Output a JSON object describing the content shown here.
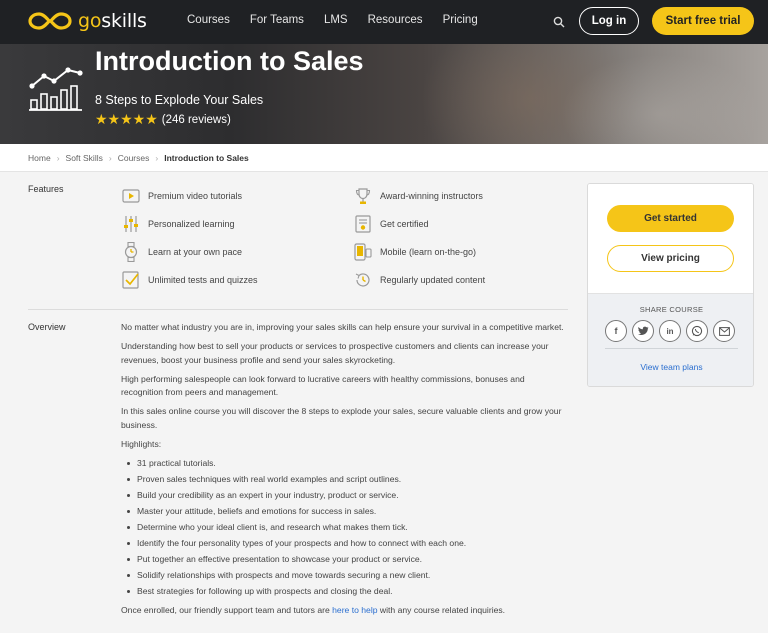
{
  "nav": {
    "logo_go": "go",
    "logo_rest": "skills",
    "links": [
      "Courses",
      "For Teams",
      "LMS",
      "Resources",
      "Pricing"
    ],
    "login": "Log in",
    "trial": "Start free trial"
  },
  "hero": {
    "title": "Introduction to Sales",
    "subtitle": "8 Steps to Explode Your Sales",
    "stars": "★★★★★",
    "rating": 5,
    "reviews": "(246 reviews)"
  },
  "breadcrumb": [
    "Home",
    "Soft Skills",
    "Courses",
    "Introduction to Sales"
  ],
  "features": {
    "label": "Features",
    "left": [
      {
        "label": "Premium video tutorials",
        "icon": "video-icon"
      },
      {
        "label": "Personalized learning",
        "icon": "sliders-icon"
      },
      {
        "label": "Learn at your own pace",
        "icon": "watch-icon"
      },
      {
        "label": "Unlimited tests and quizzes",
        "icon": "checklist-icon"
      }
    ],
    "right": [
      {
        "label": "Award-winning instructors",
        "icon": "trophy-icon"
      },
      {
        "label": "Get certified",
        "icon": "certificate-icon"
      },
      {
        "label": "Mobile (learn on-the-go)",
        "icon": "mobile-icon"
      },
      {
        "label": "Regularly updated content",
        "icon": "history-icon"
      }
    ]
  },
  "overview": {
    "label": "Overview",
    "paragraphs": [
      "No matter what industry you are in, improving your sales skills can help ensure your survival in a competitive market.",
      "Understanding how best to sell your products or services to prospective customers and clients can increase your revenues, boost your business profile and send your sales skyrocketing.",
      "High performing salespeople can look forward to lucrative careers with healthy commissions, bonuses and recognition from peers and management.",
      "In this sales online course you will discover the 8 steps to explode your sales, secure valuable clients and grow your business."
    ],
    "highlights_label": "Highlights:",
    "highlights": [
      "31 practical tutorials.",
      "Proven sales techniques with real world examples and script outlines.",
      "Build your credibility as an expert in your industry, product or service.",
      "Master your attitude, beliefs and emotions for success in sales.",
      "Determine who your ideal client is, and research what makes them tick.",
      "Identify the four personality types of your prospects and how to connect with each one.",
      "Put together an effective presentation to showcase your product or service.",
      "Solidify relationships with prospects and move towards securing a new client.",
      "Best strategies for following up with prospects and closing the deal."
    ],
    "closing_before": "Once enrolled, our friendly support team and tutors are ",
    "closing_link": "here to help",
    "closing_after": " with any course related inquiries."
  },
  "card": {
    "get_started": "Get started",
    "view_pricing": "View pricing",
    "share_label": "SHARE COURSE",
    "share_icons": [
      "facebook-icon",
      "twitter-icon",
      "linkedin-icon",
      "whatsapp-icon",
      "email-icon"
    ],
    "team_plans": "View team plans"
  },
  "colors": {
    "accent": "#f5c518",
    "nav_bg": "#1f2124",
    "link": "#2a6ecf"
  }
}
